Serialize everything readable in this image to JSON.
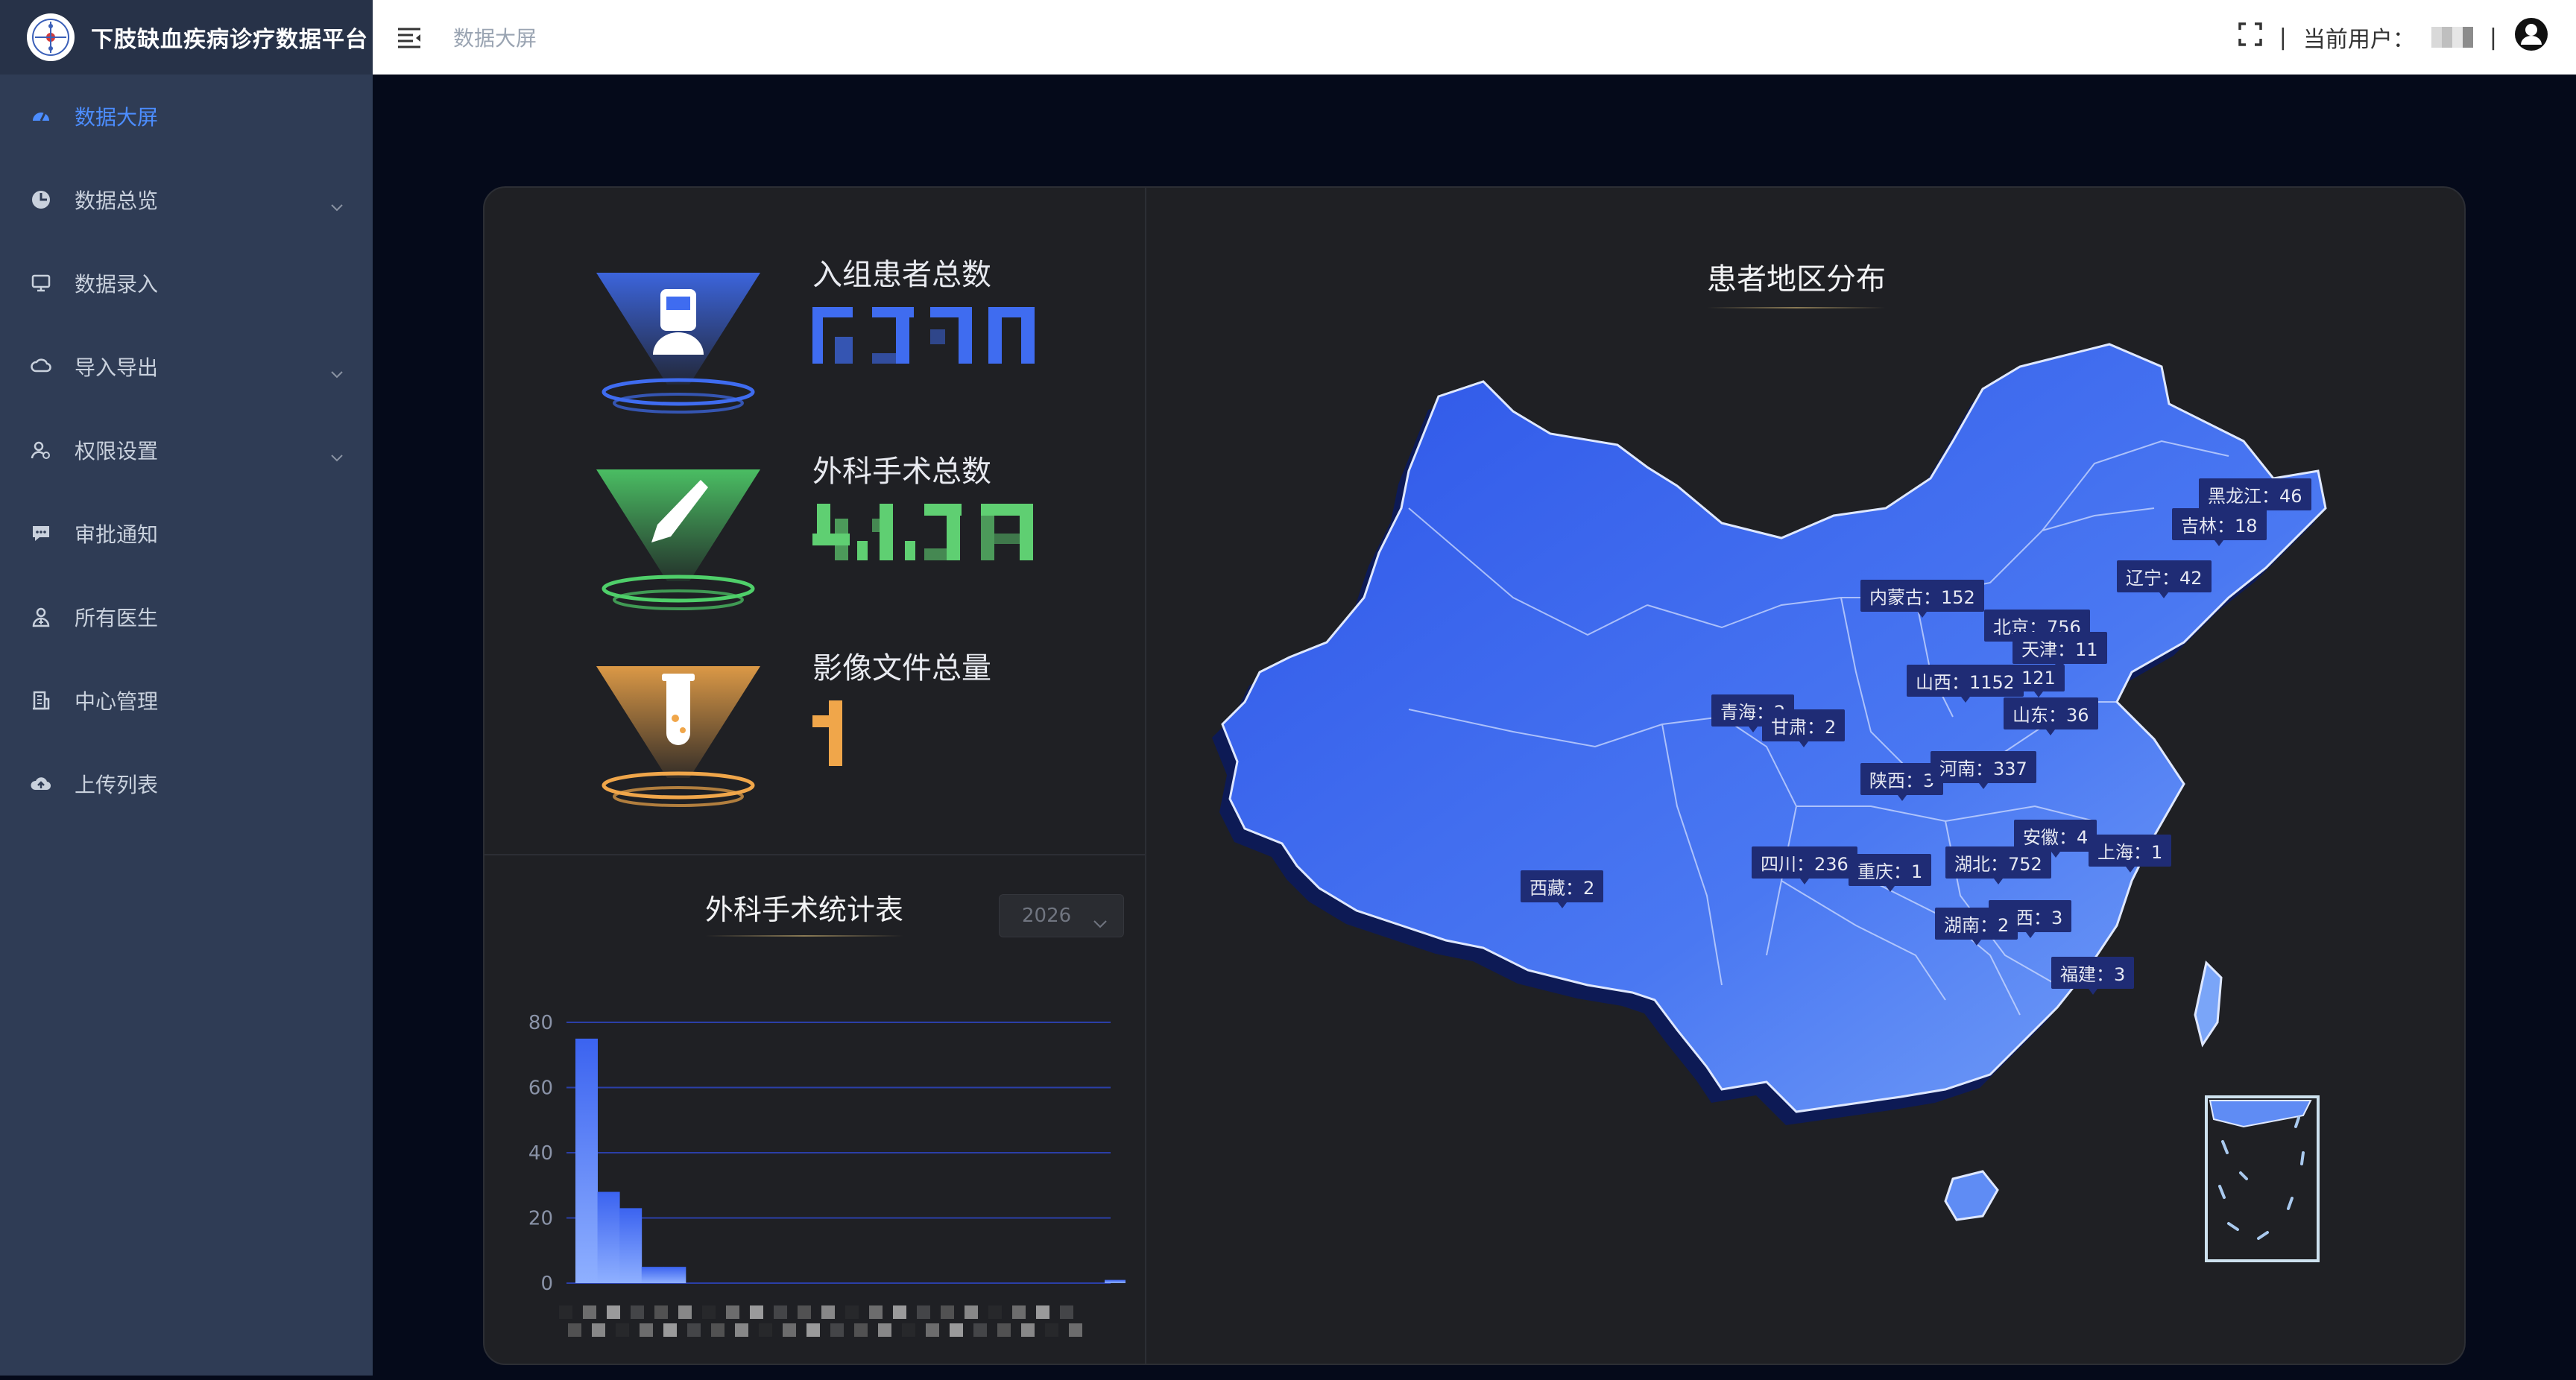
{
  "brand": {
    "title": "下肢缺血疾病诊疗数据平台"
  },
  "sidebar": {
    "items": [
      {
        "label": "数据大屏",
        "icon": "dashboard-icon",
        "active": true,
        "expandable": false
      },
      {
        "label": "数据总览",
        "icon": "overview-icon",
        "active": false,
        "expandable": true
      },
      {
        "label": "数据录入",
        "icon": "monitor-icon",
        "active": false,
        "expandable": false
      },
      {
        "label": "导入导出",
        "icon": "cloud-sync-icon",
        "active": false,
        "expandable": true
      },
      {
        "label": "权限设置",
        "icon": "user-permission-icon",
        "active": false,
        "expandable": true
      },
      {
        "label": "审批通知",
        "icon": "chat-icon",
        "active": false,
        "expandable": false
      },
      {
        "label": "所有医生",
        "icon": "doctor-icon",
        "active": false,
        "expandable": false
      },
      {
        "label": "中心管理",
        "icon": "building-icon",
        "active": false,
        "expandable": false
      },
      {
        "label": "上传列表",
        "icon": "cloud-upload-icon",
        "active": false,
        "expandable": false
      }
    ]
  },
  "topbar": {
    "breadcrumb": "数据大屏",
    "current_user_label": "当前用户：",
    "separator": "|"
  },
  "stats": {
    "patients": {
      "label": "入组患者总数",
      "color": "#3f6cf0"
    },
    "surgeries": {
      "label": "外科手术总数",
      "color": "#5fcf72"
    },
    "images": {
      "label": "影像文件总量",
      "color": "#f0a64a"
    }
  },
  "surgery_chart": {
    "title": "外科手术统计表",
    "year": "2026"
  },
  "chart_data": {
    "type": "bar",
    "title": "外科手术统计表",
    "ylim": [
      0,
      80
    ],
    "yticks": [
      "0",
      "20",
      "40",
      "60",
      "80"
    ],
    "values": [
      75,
      28,
      23,
      5,
      5,
      0,
      0,
      0,
      0,
      0,
      0,
      0,
      0,
      0,
      0,
      0,
      0,
      0,
      0,
      0,
      0,
      0,
      0,
      0,
      1
    ],
    "grid": true
  },
  "map": {
    "title": "患者地区分布",
    "labels": [
      {
        "text": "黑龙江：46"
      },
      {
        "text": "吉林：18"
      },
      {
        "text": "辽宁：42"
      },
      {
        "text": "内蒙古：152"
      },
      {
        "text": "北京：756"
      },
      {
        "text": "天津：11"
      },
      {
        "text": "山西：1152"
      },
      {
        "text": "121"
      },
      {
        "text": "山东：36"
      },
      {
        "text": "青海：2"
      },
      {
        "text": "甘肃：2"
      },
      {
        "text": "陕西：3"
      },
      {
        "text": "河南：337"
      },
      {
        "text": "安徽：4"
      },
      {
        "text": "上海：1"
      },
      {
        "text": "四川：236"
      },
      {
        "text": "重庆：1"
      },
      {
        "text": "湖北：752"
      },
      {
        "text": "江西：3"
      },
      {
        "text": "湖南：2"
      },
      {
        "text": "西藏：2"
      },
      {
        "text": "福建：3"
      }
    ]
  }
}
